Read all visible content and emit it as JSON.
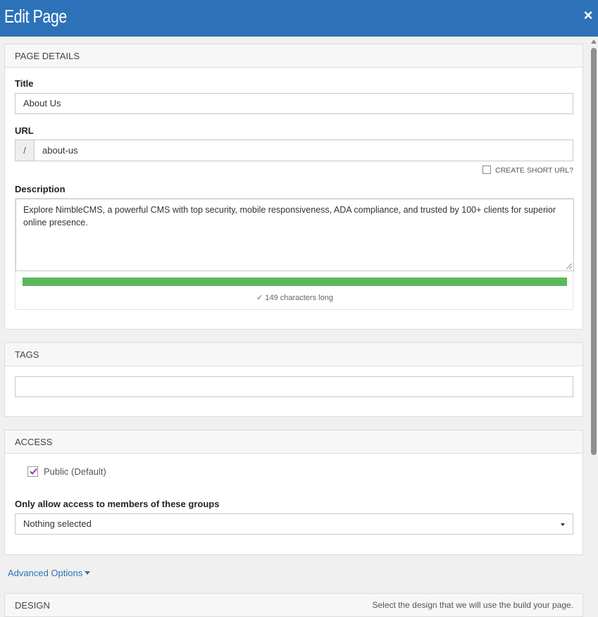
{
  "header": {
    "title": "Edit Page",
    "close_icon": "×"
  },
  "page_details": {
    "heading": "PAGE DETAILS",
    "title_label": "Title",
    "title_value": "About Us",
    "url_label": "URL",
    "url_prefix": "/",
    "url_value": "about-us",
    "short_url_label": "CREATE SHORT URL?",
    "description_label": "Description",
    "description_value": "Explore NimbleCMS, a powerful CMS with top security, mobile responsiveness, ADA compliance, and trusted by 100+ clients for superior online presence.",
    "char_count": "✓ 149 characters long",
    "bar_color": "#5cb85c"
  },
  "tags": {
    "heading": "TAGS",
    "value": ""
  },
  "access": {
    "heading": "ACCESS",
    "public_label": "Public (Default)",
    "public_checked": true,
    "groups_label": "Only allow access to members of these groups",
    "groups_value": "Nothing selected"
  },
  "advanced": {
    "label": "Advanced Options"
  },
  "design": {
    "heading": "DESIGN",
    "note": "Select the design that we will use the build your page."
  },
  "colors": {
    "header": "#2d72b8",
    "checkmark": "#8e3ab5"
  }
}
